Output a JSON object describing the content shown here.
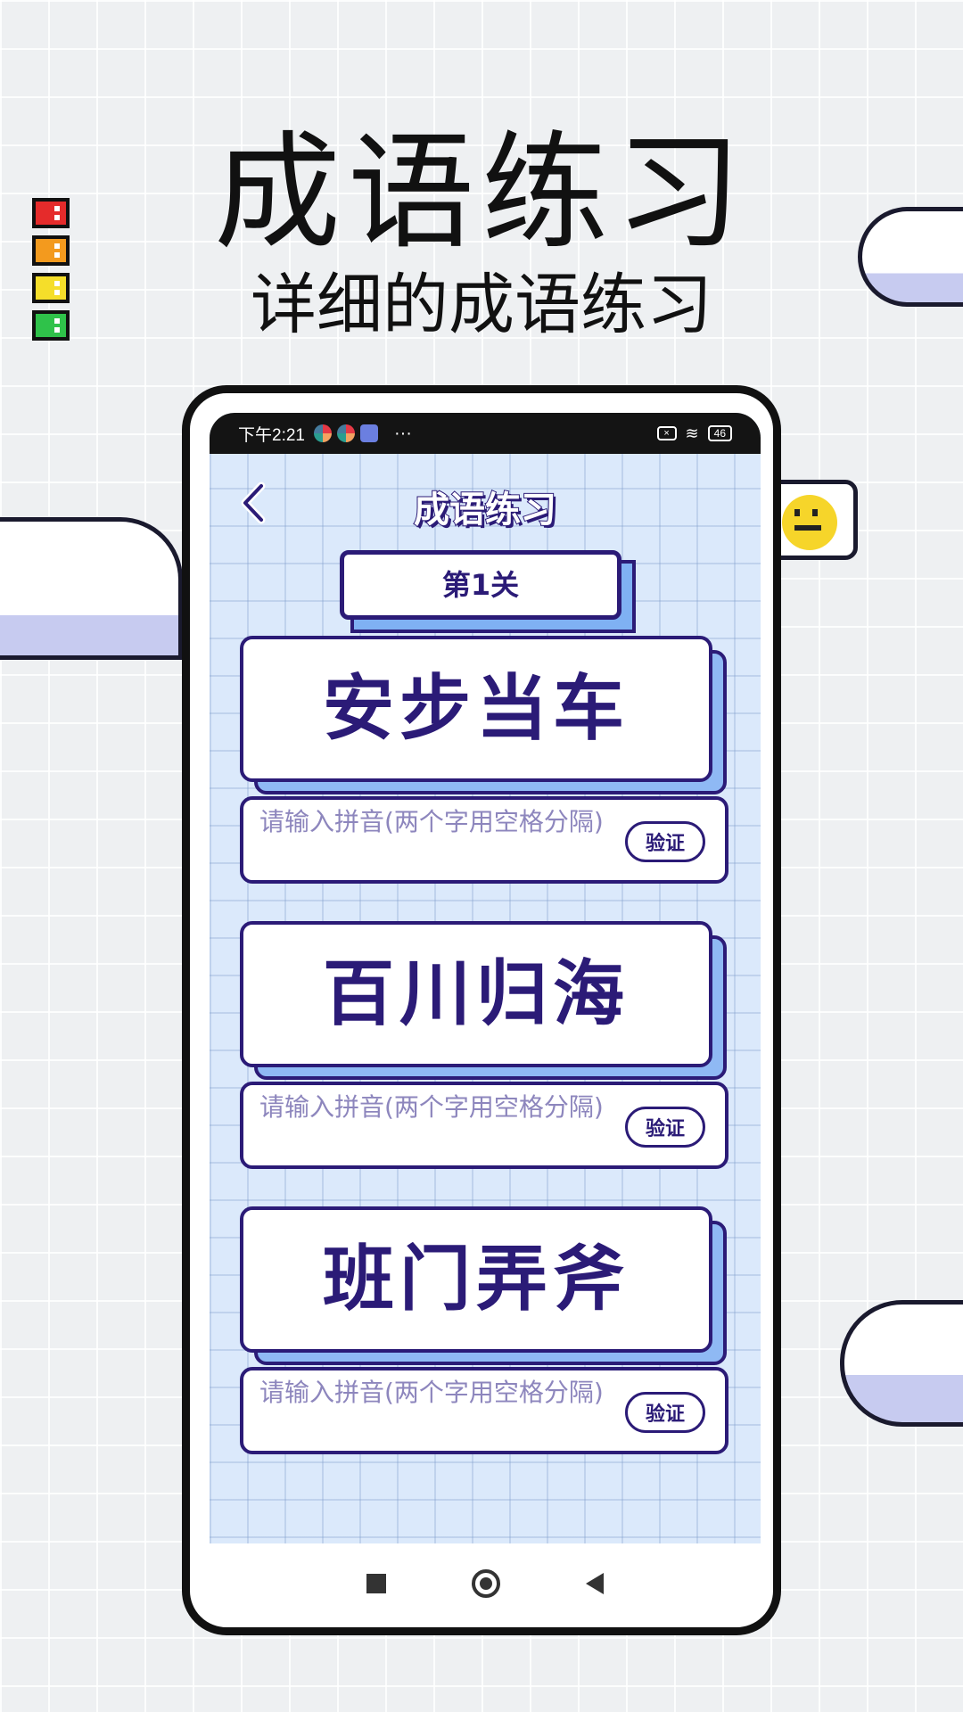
{
  "promo": {
    "title": "成语练习",
    "subtitle": "详细的成语练习"
  },
  "decoration": {
    "block_colors": [
      "#e52b2b",
      "#f39a1e",
      "#f5de2a",
      "#2fc24a"
    ]
  },
  "status_bar": {
    "time": "下午2:21",
    "more": "···",
    "x_badge": "×",
    "wifi": "≋",
    "battery": "46"
  },
  "app": {
    "title": "成语练习",
    "back_icon": "chevron-left-icon",
    "level_label": "第1关",
    "questions": [
      {
        "idiom": "安步当车",
        "placeholder": "请输入拼音(两个字用空格分隔)",
        "value": "",
        "verify_label": "验证"
      },
      {
        "idiom": "百川归海",
        "placeholder": "请输入拼音(两个字用空格分隔)",
        "value": "",
        "verify_label": "验证"
      },
      {
        "idiom": "班门弄斧",
        "placeholder": "请输入拼音(两个字用空格分隔)",
        "value": "",
        "verify_label": "验证"
      }
    ]
  },
  "nav": {
    "icons": [
      "square-icon",
      "home-circle-icon",
      "back-triangle-icon"
    ]
  },
  "colors": {
    "accent": "#2b1b77",
    "card_shadow": "#8fb9f4",
    "screen_bg": "#dbe9fb"
  }
}
